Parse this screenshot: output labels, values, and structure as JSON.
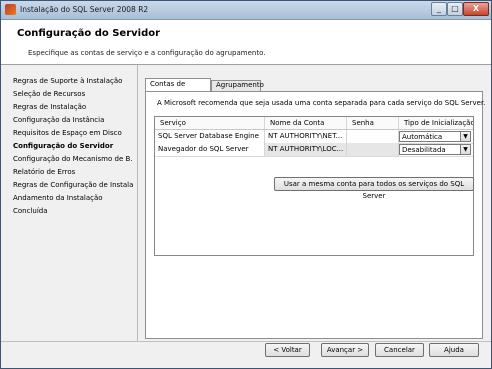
{
  "window": {
    "title": "Instalação do SQL Server 2008 R2",
    "controls": {
      "minimize": "_",
      "maximize": "□",
      "close": "X"
    }
  },
  "header": {
    "title": "Configuração do Servidor",
    "subtitle": "Especifique as contas de serviço e a configuração do agrupamento."
  },
  "sidebar": {
    "items": [
      {
        "label": "Regras de Suporte à Instalação",
        "active": false
      },
      {
        "label": "Seleção de Recursos",
        "active": false
      },
      {
        "label": "Regras de Instalação",
        "active": false
      },
      {
        "label": "Configuração da Instância",
        "active": false
      },
      {
        "label": "Requisitos de Espaço em Disco",
        "active": false
      },
      {
        "label": "Configuração do Servidor",
        "active": true
      },
      {
        "label": "Configuração do Mecanismo de B...",
        "active": false
      },
      {
        "label": "Relatório de Erros",
        "active": false
      },
      {
        "label": "Regras de Configuração de Instala...",
        "active": false
      },
      {
        "label": "Andamento da Instalação",
        "active": false
      },
      {
        "label": "Concluída",
        "active": false
      }
    ]
  },
  "tabs": [
    {
      "label": "Contas de Serviço",
      "selected": true
    },
    {
      "label": "Agrupamento",
      "selected": false
    }
  ],
  "service_accounts": {
    "info": "A Microsoft recomenda que seja usada uma conta separada para cada serviço do SQL Server.",
    "columns": [
      "Serviço",
      "Nome da Conta",
      "Senha",
      "Tipo de Inicialização"
    ],
    "rows": [
      {
        "service": "SQL Server Database Engine",
        "account": "NT AUTHORITY\\NET...",
        "password": "",
        "startup": "Automática"
      },
      {
        "service": "Navegador do SQL Server",
        "account": "NT AUTHORITY\\LOC...",
        "password": "",
        "startup": "Desabilitada"
      }
    ],
    "same_account_button": "Usar a mesma conta para todos os serviços do SQL Server"
  },
  "footer": {
    "back": "< Voltar",
    "next": "Avançar >",
    "cancel": "Cancelar",
    "help": "Ajuda"
  },
  "colors": {
    "titlebar": "#a8bfd7",
    "header_bg": "#ffffff",
    "panel_bg": "#ffffff",
    "window_bg": "#f0f0f0"
  }
}
